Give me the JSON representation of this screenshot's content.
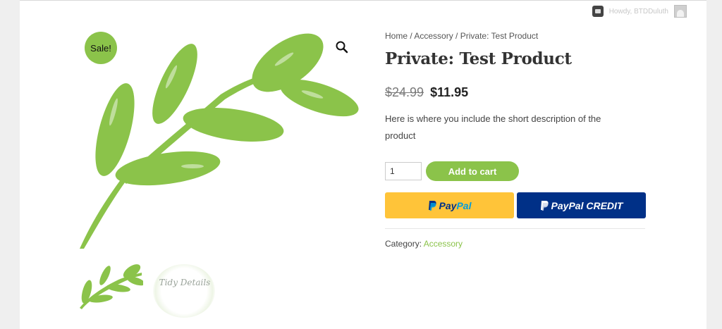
{
  "admin_bar": {
    "greeting": "Howdy, BTDDuluth"
  },
  "product": {
    "sale_badge": "Sale!",
    "breadcrumb": {
      "home": "Home",
      "separator": " / ",
      "category": "Accessory",
      "current": "Private: Test Product"
    },
    "title": "Private: Test Product",
    "old_price": "$24.99",
    "new_price": "$11.95",
    "short_description": "Here is where you include the short description of the product",
    "quantity": "1",
    "add_to_cart_label": "Add to cart",
    "paypal": {
      "pay": "Pay",
      "pal": "Pal",
      "credit_label": "PayPal CREDIT"
    },
    "meta": {
      "category_label": "Category:",
      "category_value": "Accessory"
    },
    "thumbnail_2": {
      "text": "Tidy Details"
    }
  },
  "colors": {
    "accent_green": "#8bc34a",
    "paypal_yellow": "#ffc439",
    "paypal_blue": "#003087"
  },
  "icons": [
    "search-icon",
    "comment-icon",
    "user-avatar-icon",
    "paypal-logo-icon"
  ]
}
